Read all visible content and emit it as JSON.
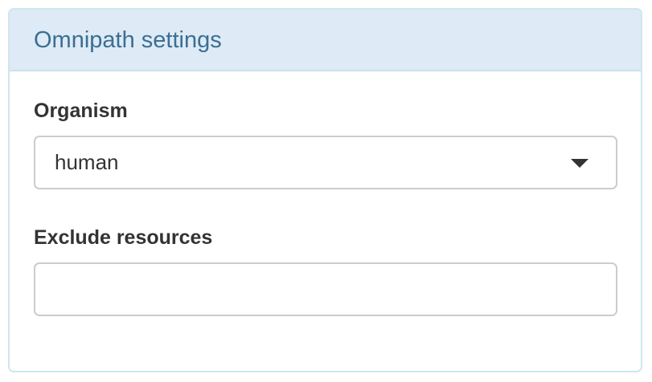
{
  "panel": {
    "title": "Omnipath settings"
  },
  "fields": {
    "organism": {
      "label": "Organism",
      "value": "human",
      "icon": "chevron-down-icon"
    },
    "exclude_resources": {
      "label": "Exclude resources",
      "value": "",
      "placeholder": ""
    }
  },
  "colors": {
    "heading_bg": "#deeaf5",
    "heading_text": "#3a6f93",
    "border": "#cfe6ee"
  }
}
